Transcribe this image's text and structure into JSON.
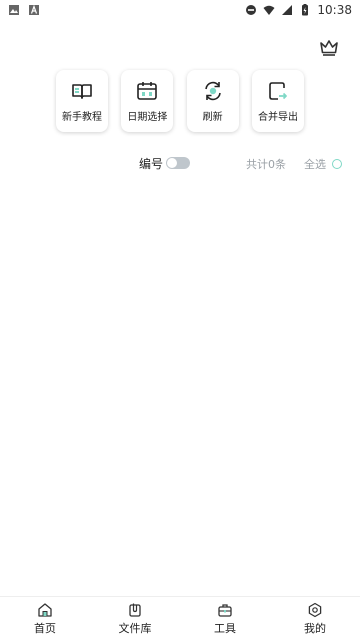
{
  "status_bar": {
    "time": "10:38",
    "icons": [
      "image-icon",
      "a-letter-icon",
      "dnd-icon",
      "wifi-icon",
      "signal-icon",
      "battery-icon"
    ]
  },
  "header": {
    "crown_icon": "crown-icon"
  },
  "tools": [
    {
      "label": "新手教程",
      "icon": "book-icon"
    },
    {
      "label": "日期选择",
      "icon": "calendar-icon"
    },
    {
      "label": "刷新",
      "icon": "refresh-icon"
    },
    {
      "label": "合并导出",
      "icon": "export-icon"
    }
  ],
  "filter": {
    "numbering_label": "编号",
    "numbering_enabled": false,
    "total_text": "共计0条",
    "select_all_label": "全选"
  },
  "bottom_nav": [
    {
      "label": "首页",
      "icon": "home-icon"
    },
    {
      "label": "文件库",
      "icon": "files-icon"
    },
    {
      "label": "工具",
      "icon": "toolbox-icon"
    },
    {
      "label": "我的",
      "icon": "profile-icon"
    }
  ],
  "colors": {
    "accent": "#7fd8c6",
    "text": "#222222",
    "muted": "#9aa0a6",
    "toggle_off": "#bfc6cc"
  }
}
